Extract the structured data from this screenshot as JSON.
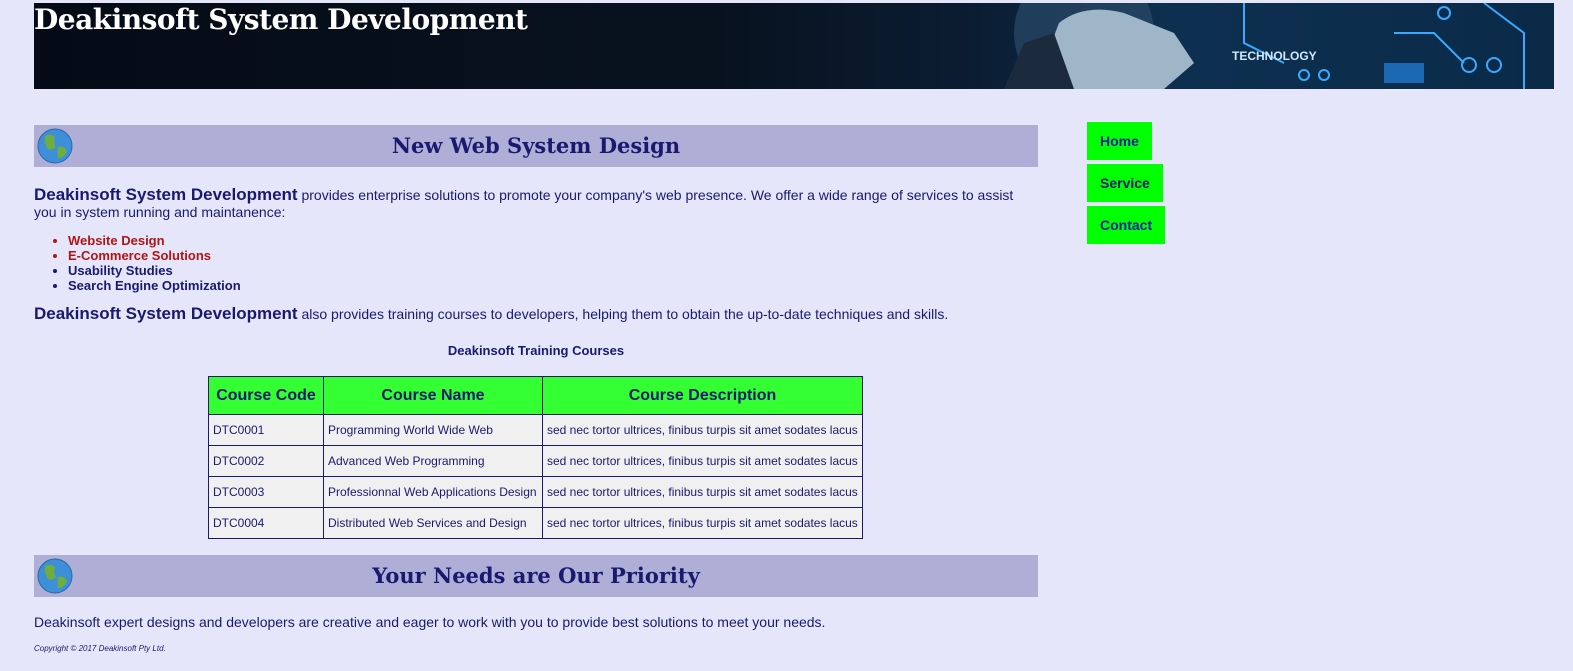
{
  "header": {
    "title": "Deakinsoft System Development",
    "banner_word": "TECHNOLOGY"
  },
  "section1": {
    "title": "New Web System Design"
  },
  "intro": {
    "brand": "Deakinsoft System Development",
    "text": " provides enterprise solutions to promote your company's web presence. We offer a wide range of services to assist you in system running and maintanence:"
  },
  "services": [
    "Website Design",
    "E-Commerce Solutions",
    "Usability Studies",
    "Search Engine Optimization"
  ],
  "training": {
    "brand": "Deakinsoft System Development",
    "text": " also provides training courses to developers, helping them to obtain the up-to-date techniques and skills."
  },
  "courses": {
    "caption": "Deakinsoft Training Courses",
    "headers": [
      "Course Code",
      "Course Name",
      "Course Description"
    ],
    "rows": [
      [
        "DTC0001",
        "Programming World Wide Web",
        "sed nec tortor ultrices, finibus turpis sit amet sodates lacus"
      ],
      [
        "DTC0002",
        "Advanced Web Programming",
        "sed nec tortor ultrices, finibus turpis sit amet sodates lacus"
      ],
      [
        "DTC0003",
        "Professionnal Web Applications Design",
        "sed nec tortor ultrices, finibus turpis sit amet sodates lacus"
      ],
      [
        "DTC0004",
        "Distributed Web Services and Design",
        "sed nec tortor ultrices, finibus turpis sit amet sodates lacus"
      ]
    ]
  },
  "section2": {
    "title": "Your Needs are Our Priority"
  },
  "needs": {
    "text": "Deakinsoft expert designs and developers are creative and eager to work with you to provide best solutions to meet your needs."
  },
  "footer": {
    "copyright": "Copyright © 2017 Deakinsoft Pty Ltd."
  },
  "nav": {
    "items": [
      "Home",
      "Service",
      "Contact"
    ]
  },
  "colors": {
    "background": "#e6e6fa",
    "section_bar": "#aeaed6",
    "nav_green": "#00ff00",
    "table_header": "#33ff33",
    "navy": "#191970",
    "accent_red": "#b01515"
  }
}
